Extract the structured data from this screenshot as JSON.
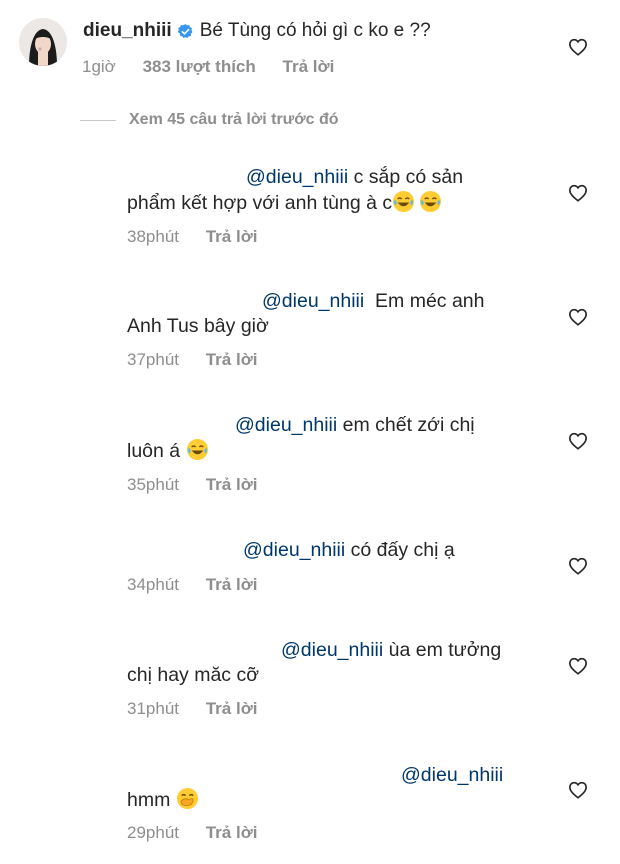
{
  "main_comment": {
    "username": "dieu_nhiii",
    "text": "Bé Tùng có hỏi gì c ko e ??",
    "time": "1giờ",
    "likes": "383 lượt thích",
    "reply_label": "Trả lời"
  },
  "view_previous": "Xem 45 câu trả lời trước đó",
  "replies": [
    {
      "mention": "@dieu_nhiii",
      "line1": " c sắp có sản",
      "line2": "phẩm kết hợp với anh tùng à c",
      "emoji": [
        "laughing-tears-emoji",
        "laughing-tears-emoji"
      ],
      "time": "38phút",
      "reply_label": "Trả lời"
    },
    {
      "mention": "@dieu_nhiii",
      "line1": "  Em méc anh",
      "line2": "Anh Tus bây giờ",
      "time": "37phút",
      "reply_label": "Trả lời"
    },
    {
      "mention": "@dieu_nhiii",
      "line1": " em chết zới chị",
      "line2": "luôn á ",
      "emoji": [
        "laughing-tears-emoji"
      ],
      "time": "35phút",
      "reply_label": "Trả lời"
    },
    {
      "mention": "@dieu_nhiii",
      "line1": " có đấy chị ạ",
      "time": "34phút",
      "reply_label": "Trả lời"
    },
    {
      "mention": "@dieu_nhiii",
      "line1": " ùa em tưởng",
      "line2": "chị hay măc cỡ",
      "time": "31phút",
      "reply_label": "Trả lời"
    },
    {
      "mention": "@dieu_nhiii",
      "line2": "hmm ",
      "emoji": [
        "face-with-hand-over-mouth-emoji"
      ],
      "time": "29phút",
      "reply_label": "Trả lời"
    }
  ],
  "icons": {
    "heart": "heart-outline-icon",
    "verified": "verified-badge-icon"
  },
  "colors": {
    "mention": "#00376b",
    "secondary_text": "#8e8e8e",
    "verified": "#3897f0"
  }
}
